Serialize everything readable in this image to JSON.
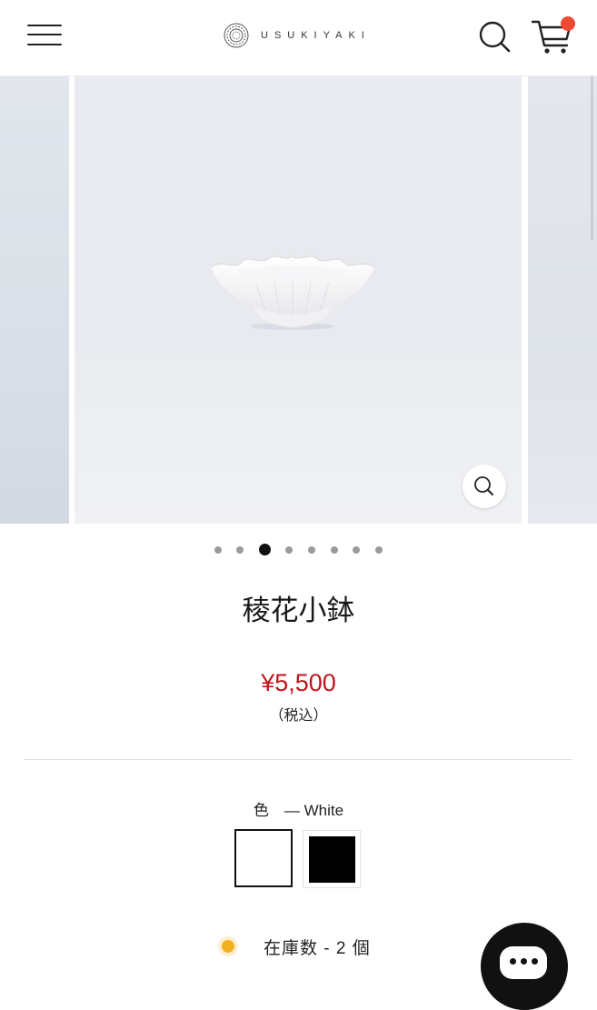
{
  "header": {
    "menu_icon": "hamburger-menu-icon",
    "brand": "USUKIYAKI",
    "search_icon": "search-icon",
    "cart_icon": "cart-icon",
    "cart_badge_color": "#ef4a32"
  },
  "gallery": {
    "slide_count": 8,
    "active_index": 2,
    "zoom_icon": "zoom-icon"
  },
  "product": {
    "title": "稜花小鉢",
    "price": "¥5,500",
    "tax_note": "（税込）",
    "price_color": "#c0161d",
    "color_label": "色　— White",
    "swatches": [
      {
        "name": "White",
        "color": "#ffffff",
        "selected": true
      },
      {
        "name": "Black",
        "color": "#000000",
        "selected": false
      }
    ],
    "stock_text": "在庫数 - 2 個",
    "stock_indicator_color": "#f2b120"
  },
  "chat": {
    "icon": "chat-bubble-icon"
  }
}
